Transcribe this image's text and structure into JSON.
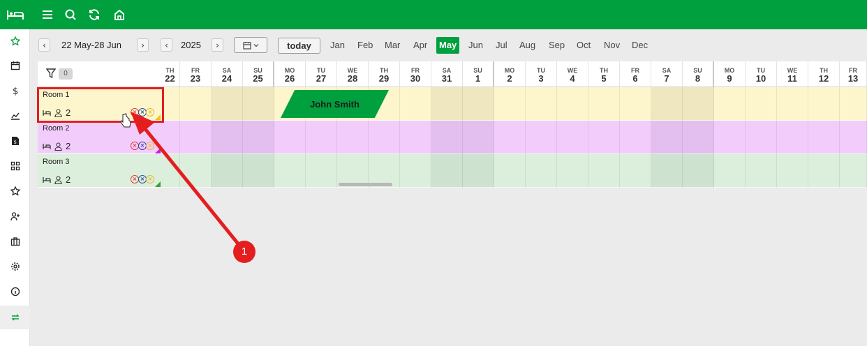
{
  "sidebar": {
    "items": [
      {
        "icon": "star-icon",
        "name": "sidebar-item-favorites"
      },
      {
        "icon": "calendar-icon",
        "name": "sidebar-item-calendar"
      },
      {
        "icon": "dollar-icon",
        "name": "sidebar-item-finance"
      },
      {
        "icon": "chart-icon",
        "name": "sidebar-item-reports"
      },
      {
        "icon": "invoice-icon",
        "name": "sidebar-item-invoices"
      },
      {
        "icon": "grid-icon",
        "name": "sidebar-item-rooms"
      },
      {
        "icon": "star-outline-icon",
        "name": "sidebar-item-reviews"
      },
      {
        "icon": "add-user-icon",
        "name": "sidebar-item-guests"
      },
      {
        "icon": "briefcase-icon",
        "name": "sidebar-item-business"
      },
      {
        "icon": "gear-icon",
        "name": "sidebar-item-settings"
      },
      {
        "icon": "info-icon",
        "name": "sidebar-item-info"
      },
      {
        "icon": "sync-icon",
        "name": "sidebar-item-sync"
      }
    ],
    "active_index": 11
  },
  "toolbar": {
    "date_range": "22 May-28 Jun",
    "year": "2025",
    "today_label": "today",
    "prev_symbol": "‹",
    "next_symbol": "›",
    "months": [
      "Jan",
      "Feb",
      "Mar",
      "Apr",
      "May",
      "Jun",
      "Jul",
      "Aug",
      "Sep",
      "Oct",
      "Nov",
      "Dec"
    ],
    "active_month": "May"
  },
  "grid": {
    "filter_count": "0",
    "days": [
      {
        "dow": "TH",
        "num": "22"
      },
      {
        "dow": "FR",
        "num": "23"
      },
      {
        "dow": "SA",
        "num": "24"
      },
      {
        "dow": "SU",
        "num": "25"
      },
      {
        "dow": "MO",
        "num": "26"
      },
      {
        "dow": "TU",
        "num": "27"
      },
      {
        "dow": "WE",
        "num": "28"
      },
      {
        "dow": "TH",
        "num": "29"
      },
      {
        "dow": "FR",
        "num": "30"
      },
      {
        "dow": "SA",
        "num": "31"
      },
      {
        "dow": "SU",
        "num": "1"
      },
      {
        "dow": "MO",
        "num": "2"
      },
      {
        "dow": "TU",
        "num": "3"
      },
      {
        "dow": "WE",
        "num": "4"
      },
      {
        "dow": "TH",
        "num": "5"
      },
      {
        "dow": "FR",
        "num": "6"
      },
      {
        "dow": "SA",
        "num": "7"
      },
      {
        "dow": "SU",
        "num": "8"
      },
      {
        "dow": "MO",
        "num": "9"
      },
      {
        "dow": "TU",
        "num": "10"
      },
      {
        "dow": "WE",
        "num": "11"
      },
      {
        "dow": "TH",
        "num": "12"
      },
      {
        "dow": "FR",
        "num": "13"
      }
    ],
    "rooms": [
      {
        "name": "Room 1",
        "guests": "2",
        "color": "#fdf6cd",
        "weekend_color": "#efe7bf",
        "corner_color": "#f0c419"
      },
      {
        "name": "Room 2",
        "guests": "2",
        "color": "#f2cdfc",
        "weekend_color": "#e3bfef",
        "corner_color": "#c71fd8"
      },
      {
        "name": "Room 3",
        "guests": "2",
        "color": "#dcefdc",
        "weekend_color": "#cde2cf",
        "corner_color": "#3aa03a"
      }
    ],
    "bookings": [
      {
        "guest": "John Smith",
        "room": "Room 1"
      }
    ]
  },
  "annotation": {
    "number": "1",
    "color": "#e41e1e"
  },
  "colors": {
    "brand": "#00a03e",
    "background": "#ebebeb"
  }
}
